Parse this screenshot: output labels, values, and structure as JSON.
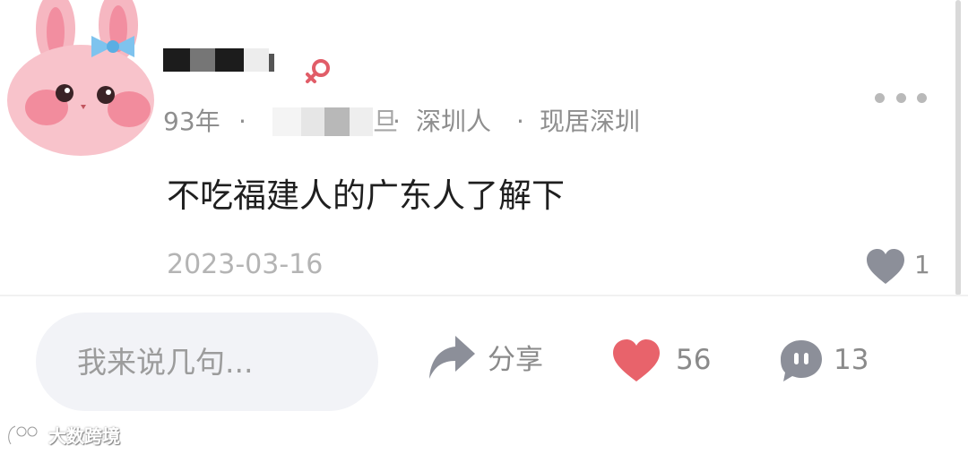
{
  "post": {
    "meta": {
      "age": "93年",
      "separator": "·",
      "hidden_tail": "旦",
      "hometown": "深圳人",
      "residence": "现居深圳"
    },
    "text": "不吃福建人的广东人了解下",
    "date": "2023-03-16",
    "like_count": "1"
  },
  "bottom_bar": {
    "input_placeholder": "我来说几句...",
    "share_label": "分享",
    "like_count": "56",
    "comment_count": "13"
  },
  "watermark": {
    "text": "大数跨境"
  },
  "colors": {
    "heart_red": "#e8636b",
    "icon_gray": "#8c8f99",
    "meta_gray": "#8e8e8e",
    "input_bg": "#f2f3f7",
    "gender_red": "#e15d68"
  },
  "icons": [
    "bunny-avatar",
    "female-icon",
    "more-dots-icon",
    "heart-icon",
    "share-arrow-icon",
    "comment-bubble-icon",
    "watermark-logo-icon"
  ]
}
